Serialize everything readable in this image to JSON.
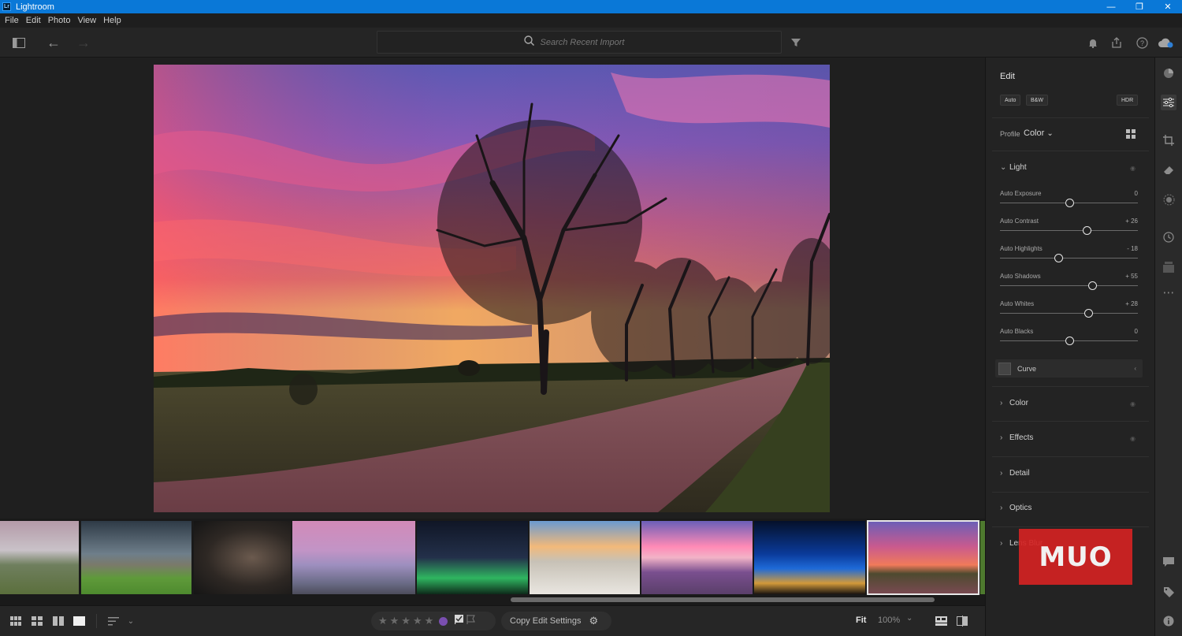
{
  "app": {
    "title": "Lightroom",
    "icon_text": "Lr"
  },
  "window_controls": {
    "minimize": "—",
    "maximize": "❐",
    "close": "✕"
  },
  "menu": [
    "File",
    "Edit",
    "Photo",
    "View",
    "Help"
  ],
  "toolbar": {
    "search_placeholder": "Search Recent Import"
  },
  "edit_panel": {
    "title": "Edit",
    "buttons": {
      "auto": "Auto",
      "bw": "B&W",
      "hdr": "HDR"
    },
    "profile_label": "Profile",
    "profile_value": "Color",
    "light": {
      "label": "Light",
      "sliders": [
        {
          "label": "Auto Exposure",
          "value": "0",
          "pos": 0.5
        },
        {
          "label": "Auto Contrast",
          "value": "+ 26",
          "pos": 0.63
        },
        {
          "label": "Auto Highlights",
          "value": "- 18",
          "pos": 0.42
        },
        {
          "label": "Auto Shadows",
          "value": "+ 55",
          "pos": 0.67
        },
        {
          "label": "Auto Whites",
          "value": "+ 28",
          "pos": 0.64
        },
        {
          "label": "Auto Blacks",
          "value": "0",
          "pos": 0.5
        }
      ],
      "curve_label": "Curve"
    },
    "sections": [
      "Color",
      "Effects",
      "Detail",
      "Optics",
      "Lens Blur"
    ]
  },
  "bottom": {
    "copy_settings": "Copy Edit Settings",
    "fit": "Fit",
    "zoom": "100%",
    "rating_stars": 5
  },
  "watermark": "MUO"
}
